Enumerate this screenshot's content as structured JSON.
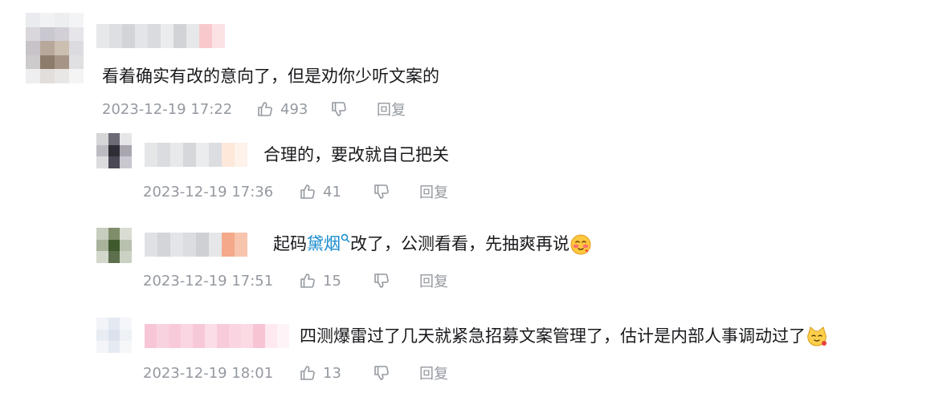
{
  "comments": [
    {
      "text": "看着确实有改的意向了，但是劝你少听文案的",
      "time": "2023-12-19 17:22",
      "likes": "493",
      "reply_label": "回复"
    },
    {
      "text": "合理的，要改就自己把关",
      "time": "2023-12-19 17:36",
      "likes": "41",
      "reply_label": "回复"
    },
    {
      "text_before_link": "起码",
      "link_text": "黛烟",
      "text_after_link": "改了，公测看看，先抽爽再说",
      "time": "2023-12-19 17:51",
      "likes": "15",
      "reply_label": "回复",
      "emoji": "blushing-face-emoji"
    },
    {
      "text": "四测爆雷过了几天就紧急招募文案管理了，估计是内部人事调动过了",
      "time": "2023-12-19 18:01",
      "likes": "13",
      "reply_label": "回复",
      "emoji": "cat-face-emoji"
    }
  ],
  "icons": {
    "like": "thumbs-up-icon",
    "dislike": "thumbs-down-icon",
    "link_search": "search-icon"
  },
  "colors": {
    "text": "#18191c",
    "meta": "#9499a0",
    "link": "#178bcf"
  }
}
